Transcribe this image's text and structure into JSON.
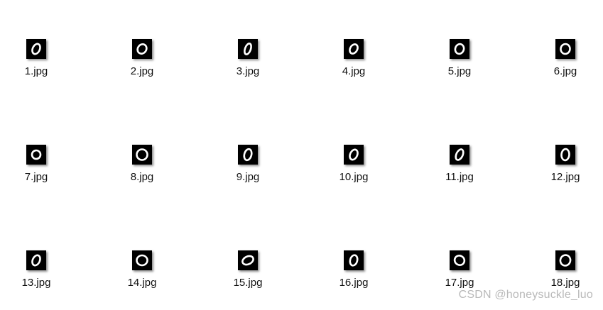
{
  "files": [
    {
      "name": "1.jpg",
      "icon": "digit-zero-thumbnail-icon"
    },
    {
      "name": "2.jpg",
      "icon": "digit-zero-thumbnail-icon"
    },
    {
      "name": "3.jpg",
      "icon": "digit-zero-thumbnail-icon"
    },
    {
      "name": "4.jpg",
      "icon": "digit-zero-thumbnail-icon"
    },
    {
      "name": "5.jpg",
      "icon": "digit-zero-thumbnail-icon"
    },
    {
      "name": "6.jpg",
      "icon": "digit-zero-thumbnail-icon"
    },
    {
      "name": "7.jpg",
      "icon": "digit-zero-thumbnail-icon"
    },
    {
      "name": "8.jpg",
      "icon": "digit-zero-thumbnail-icon"
    },
    {
      "name": "9.jpg",
      "icon": "digit-zero-thumbnail-icon"
    },
    {
      "name": "10.jpg",
      "icon": "digit-zero-thumbnail-icon"
    },
    {
      "name": "11.jpg",
      "icon": "digit-zero-thumbnail-icon"
    },
    {
      "name": "12.jpg",
      "icon": "digit-zero-thumbnail-icon"
    },
    {
      "name": "13.jpg",
      "icon": "digit-zero-thumbnail-icon"
    },
    {
      "name": "14.jpg",
      "icon": "digit-zero-thumbnail-icon"
    },
    {
      "name": "15.jpg",
      "icon": "digit-zero-thumbnail-icon"
    },
    {
      "name": "16.jpg",
      "icon": "digit-zero-thumbnail-icon"
    },
    {
      "name": "17.jpg",
      "icon": "digit-zero-thumbnail-icon"
    },
    {
      "name": "18.jpg",
      "icon": "digit-zero-thumbnail-icon"
    }
  ],
  "watermark": "CSDN @honeysuckle_luo"
}
